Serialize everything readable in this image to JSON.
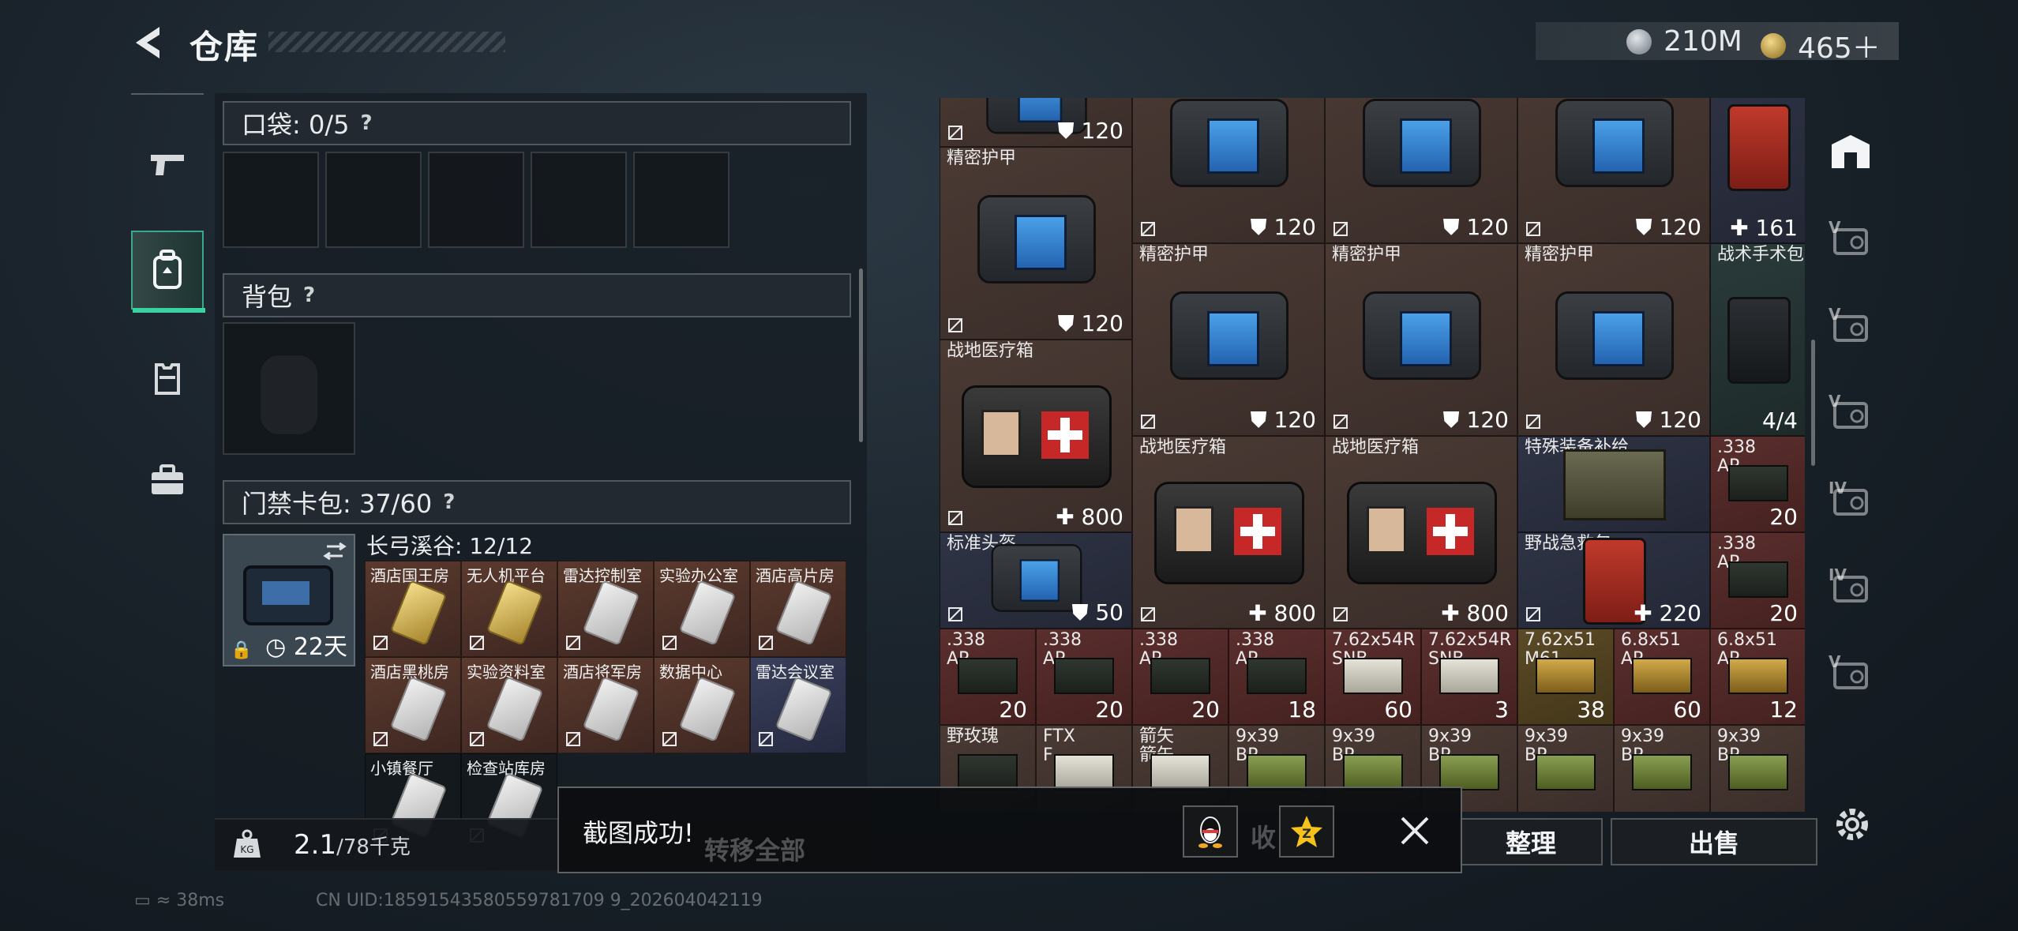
{
  "header": {
    "title": "仓库",
    "currency_silver": "210M",
    "currency_gold": "465＋",
    "colors": {
      "accent_green": "#3bd1a2",
      "cell_brown": "#4b3a34",
      "cell_red": "#5a2f2e",
      "cell_navy": "#2f3446"
    }
  },
  "left_rail": {
    "items": [
      {
        "icon": "pistol-icon"
      },
      {
        "icon": "backpack-icon",
        "active": true
      },
      {
        "icon": "armor-vest-icon"
      },
      {
        "icon": "briefcase-icon"
      }
    ]
  },
  "pockets": {
    "label": "口袋: 0/5",
    "help": "?",
    "slot_count": 5
  },
  "backpack": {
    "label": "背包",
    "help": "?"
  },
  "key_case": {
    "label": "门禁卡包: 37/60",
    "help": "?",
    "time_left": "22天",
    "zone_title": "长弓溪谷: 12/12",
    "keys": [
      {
        "name": "酒店国王房",
        "card": "gold",
        "bg": "brown"
      },
      {
        "name": "无人机平台",
        "card": "gold",
        "bg": "brown"
      },
      {
        "name": "雷达控制室",
        "card": "silver",
        "bg": "brown"
      },
      {
        "name": "实验办公室",
        "card": "silver",
        "bg": "brown"
      },
      {
        "name": "酒店高片房",
        "card": "silver",
        "bg": "brown"
      },
      {
        "name": "酒店黑桃房",
        "card": "silver",
        "bg": "brown"
      },
      {
        "name": "实验资料室",
        "card": "silver",
        "bg": "brown"
      },
      {
        "name": "酒店将军房",
        "card": "silver",
        "bg": "brown"
      },
      {
        "name": "数据中心",
        "card": "silver",
        "bg": "brown"
      },
      {
        "name": "雷达会议室",
        "card": "silver",
        "bg": "blue"
      },
      {
        "name": "小镇餐厅",
        "card": "silver",
        "bg": "dark"
      },
      {
        "name": "检查站库房",
        "card": "silver",
        "bg": "dark"
      }
    ]
  },
  "weight": {
    "current": "2.1",
    "max": "/78千克"
  },
  "stash": {
    "items": [
      {
        "name": "",
        "value": "120",
        "kind": "armor"
      },
      {
        "name": "精密护甲",
        "value": "120",
        "kind": "armor"
      },
      {
        "name": "精密护甲",
        "value": "120",
        "kind": "armor"
      },
      {
        "name": "精密护甲",
        "value": "120",
        "kind": "armor"
      },
      {
        "name": "精密护甲",
        "value": "120",
        "kind": "armor"
      },
      {
        "name": "精密护甲",
        "value": "120",
        "kind": "armor"
      },
      {
        "name": "精密护甲",
        "value": "120",
        "kind": "armor"
      },
      {
        "name": "精密护甲",
        "value": "120",
        "kind": "armor"
      },
      {
        "name": "战地医疗箱",
        "value": "800",
        "kind": "medkit"
      },
      {
        "name": "战地医疗箱",
        "value": "800",
        "kind": "medkit"
      },
      {
        "name": "战地医疗箱",
        "value": "800",
        "kind": "medkit"
      },
      {
        "name": "标准头盔",
        "value": "50",
        "kind": "helmet"
      },
      {
        "name": "",
        "value": "161",
        "kind": "redkit"
      },
      {
        "name": "战术手术包",
        "value": "4/4",
        "kind": "surgery"
      },
      {
        "name": "特殊装备补给",
        "value": "",
        "kind": "crate"
      },
      {
        "name": "野战急救包",
        "value": "220",
        "kind": "redkit"
      },
      {
        "name": ".338\nAP",
        "value": "20"
      },
      {
        "name": ".338\nAP",
        "value": "20"
      },
      {
        "name": ".338\nAP",
        "value": "20"
      },
      {
        "name": ".338\nAP",
        "value": "20"
      },
      {
        "name": ".338\nAP",
        "value": "20"
      },
      {
        "name": ".338\nAP",
        "value": "18"
      },
      {
        "name": "7.62x54R\nSNB",
        "value": "60"
      },
      {
        "name": "7.62x54R\nSNB",
        "value": "3"
      },
      {
        "name": "7.62x51\nM61",
        "value": "38"
      },
      {
        "name": "6.8x51\nAP",
        "value": "60"
      },
      {
        "name": "6.8x51\nAP",
        "value": "12"
      },
      {
        "name": "野玫瑰",
        "value": ""
      },
      {
        "name": "FTX\nF",
        "value": ""
      },
      {
        "name": "箭矢\n箭矢",
        "value": ""
      },
      {
        "name": "9x39\nBP",
        "value": ""
      },
      {
        "name": "9x39\nBP",
        "value": ""
      },
      {
        "name": "9x39\nBP",
        "value": ""
      },
      {
        "name": "9x39\nBP",
        "value": ""
      },
      {
        "name": "9x39\nBP",
        "value": ""
      },
      {
        "name": "9x39\nBP",
        "value": ""
      }
    ]
  },
  "right_rail": {
    "items": [
      {
        "icon": "home-storage-icon",
        "label": ""
      },
      {
        "icon": "storage-v-icon",
        "label": "V"
      },
      {
        "icon": "storage-v-icon",
        "label": "V"
      },
      {
        "icon": "storage-v-icon",
        "label": "V"
      },
      {
        "icon": "storage-iv-icon",
        "label": "IV"
      },
      {
        "icon": "storage-iv-icon",
        "label": "IV"
      },
      {
        "icon": "storage-v-icon",
        "label": "V"
      }
    ]
  },
  "bottom": {
    "transfer_all": "转移全部",
    "collect": "收",
    "sort": "整理",
    "sell": "出售"
  },
  "toast": {
    "message": "截图成功!"
  },
  "status_bar": {
    "ping": "38ms",
    "uid": "CN UID:18591543580559781709 9_202604042119"
  }
}
